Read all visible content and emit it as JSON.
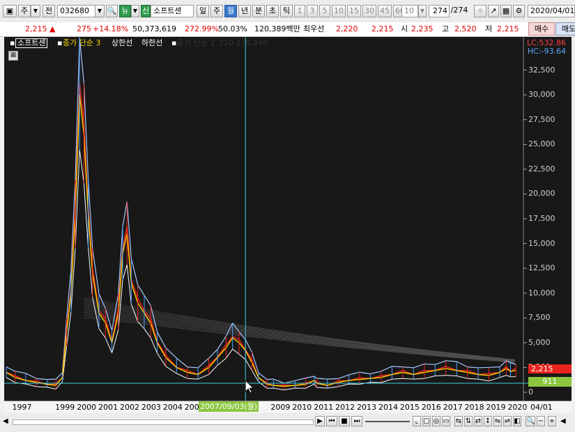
{
  "toolbar": {
    "mode_label": "주",
    "type_label": "전",
    "code": "032680",
    "news_label": "뉴",
    "new_label": "신",
    "stock_name": "소프트센",
    "period_day": "일",
    "period_week": "주",
    "period_month": "월",
    "period_year": "년",
    "period_minute": "분",
    "period_second": "초",
    "period_tick": "틱",
    "intervals": [
      "1",
      "3",
      "5",
      "10",
      "15",
      "30",
      "45",
      "60"
    ],
    "interval_value": "10",
    "count_current": "274",
    "count_total": "/274",
    "date": "2020/04/01"
  },
  "infobar": {
    "price": "2,215",
    "up_arrow": "▲",
    "change": "275",
    "change_pct": "+14.18%",
    "volume": "50,373,619",
    "volume_ratio": "272.99%",
    "ratio2": "50.03%",
    "amount": "120,389백만",
    "best_label": "최우선",
    "best_ask": "2,220",
    "best_bid": "2,215",
    "open_label": "시",
    "open": "2,235",
    "high_label": "고",
    "high": "2,520",
    "low_label": "저",
    "low": "2,215",
    "buy_label": "매수",
    "sell_label": "매도"
  },
  "chart_legend": {
    "name": "소프트센",
    "ma_label": "종가 단순 3",
    "upper_label": "상한선",
    "lower_label": "하한선",
    "ma2_label": "종가 단순 2",
    "ma2_params": "220 230 240",
    "lc_label": "LC:532.86",
    "hc_label": "HC:-93.64"
  },
  "chart_data": {
    "type": "line",
    "title": "소프트센",
    "y_ticks": [
      "32,500",
      "30,000",
      "27,500",
      "25,000",
      "22,500",
      "20,000",
      "17,500",
      "15,000",
      "12,500",
      "10,000",
      "7,500",
      "5,000",
      "2,500",
      "0"
    ],
    "x_ticks": [
      "1997",
      "1999",
      "2000",
      "2001",
      "2002",
      "2003",
      "2004",
      "2005",
      "20",
      "2009",
      "2010",
      "2011",
      "2012",
      "2013",
      "2014",
      "2015",
      "2016",
      "2017",
      "2018",
      "2019",
      "2020",
      "04/01"
    ],
    "ylim": [
      0,
      35000
    ],
    "crosshair_date": "2007/09/03(월)",
    "current_price_label": "2,215",
    "crosshair_value_label": "911",
    "x": [
      1996.6,
      1997,
      1997.5,
      1998,
      1998.5,
      1998.9,
      1999.2,
      1999.4,
      1999.6,
      1999.8,
      2000.0,
      2000.2,
      2000.4,
      2000.6,
      2000.9,
      2001.2,
      2001.5,
      2001.8,
      2002.0,
      2002.2,
      2002.4,
      2002.7,
      2003.0,
      2003.3,
      2003.6,
      2004.0,
      2004.5,
      2005.0,
      2005.5,
      2006.0,
      2006.4,
      2006.8,
      2007.1,
      2007.4,
      2007.7,
      2008.0,
      2008.3,
      2008.7,
      2009.0,
      2009.5,
      2010.0,
      2010.5,
      2010.9,
      2011.0,
      2011.5,
      2012.0,
      2012.5,
      2013.0,
      2013.5,
      2014.0,
      2014.5,
      2015.0,
      2015.5,
      2016.0,
      2016.5,
      2017.0,
      2017.5,
      2018.0,
      2018.5,
      2019.0,
      2019.5,
      2019.8,
      2020.0,
      2020.25
    ],
    "series": [
      {
        "name": "종가 단순 3",
        "values": [
          2000,
          1500,
          1200,
          1000,
          800,
          700,
          1500,
          6000,
          10000,
          18000,
          30000,
          26000,
          18000,
          12000,
          8000,
          7000,
          5000,
          8000,
          14000,
          16000,
          11000,
          9000,
          8000,
          7000,
          5000,
          3500,
          2500,
          2000,
          1800,
          2500,
          3500,
          4500,
          5500,
          5000,
          4200,
          3000,
          1500,
          800,
          700,
          600,
          700,
          800,
          1200,
          900,
          700,
          1000,
          1200,
          1300,
          1400,
          1500,
          1800,
          2000,
          1800,
          2000,
          2200,
          2400,
          2200,
          2000,
          1800,
          1700,
          2000,
          2400,
          2100,
          2215
        ]
      }
    ]
  }
}
